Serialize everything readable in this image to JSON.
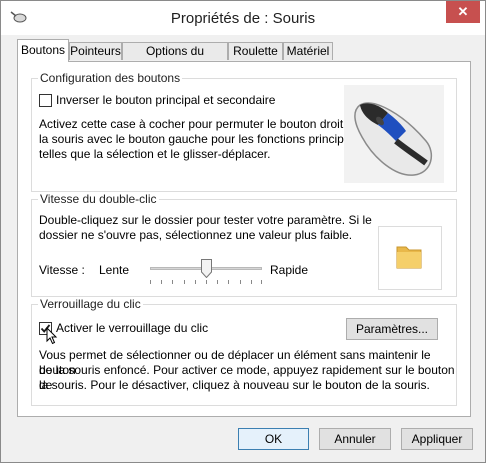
{
  "window": {
    "title": "Propriétés de : Souris",
    "close_glyph": "✕"
  },
  "tabs": [
    {
      "label": "Boutons",
      "active": true
    },
    {
      "label": "Pointeurs",
      "active": false
    },
    {
      "label": "Options du pointeur",
      "active": false
    },
    {
      "label": "Roulette",
      "active": false
    },
    {
      "label": "Matériel",
      "active": false
    }
  ],
  "button_config": {
    "title": "Configuration des boutons",
    "swap_label": "Inverser le bouton principal et secondaire",
    "swap_checked": false,
    "description": [
      "Activez cette case à cocher pour permuter le bouton droit de",
      "la souris avec le bouton gauche pour les fonctions principales",
      "telles que la sélection et le glisser-déplacer."
    ]
  },
  "double_click": {
    "title": "Vitesse du double-clic",
    "description": [
      "Double-cliquez sur le dossier pour tester votre paramètre. Si le",
      "dossier ne s'ouvre pas, sélectionnez une valeur plus faible."
    ],
    "speed_label": "Vitesse :",
    "slow_label": "Lente",
    "fast_label": "Rapide",
    "speed_value": 0.5
  },
  "click_lock": {
    "title": "Verrouillage du clic",
    "enable_label": "Activer le verrouillage du clic",
    "enable_checked": true,
    "settings_button": "Paramètres...",
    "description": [
      "Vous permet de sélectionner ou de déplacer un élément sans maintenir le bouton",
      "de la souris enfoncé. Pour activer ce mode, appuyez rapidement sur le bouton de",
      "la souris. Pour le désactiver, cliquez à nouveau sur le bouton de la souris."
    ]
  },
  "footer": {
    "ok": "OK",
    "cancel": "Annuler",
    "apply": "Appliquer"
  },
  "icons": {
    "app": "mouse-icon",
    "mouse_preview": "mouse-illustration",
    "folder": "folder-icon",
    "cursor": "arrow-cursor-icon"
  }
}
